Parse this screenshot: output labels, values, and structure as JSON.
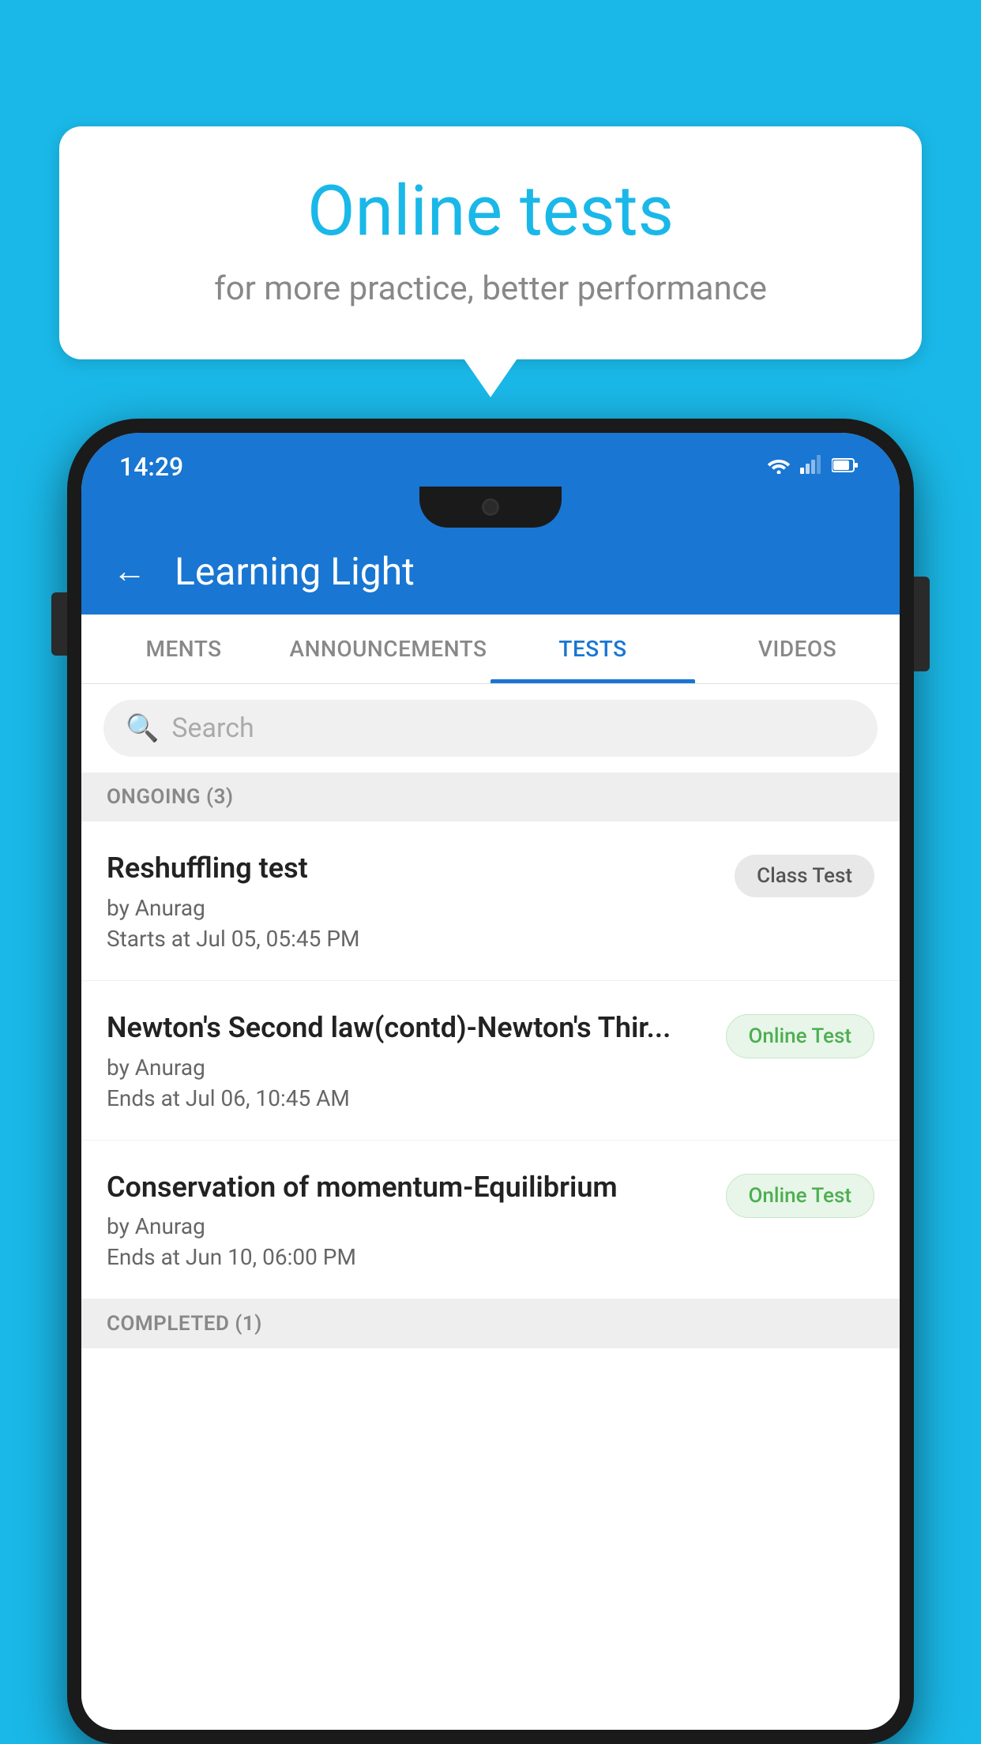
{
  "background_color": "#1ab8e8",
  "speech_bubble": {
    "title": "Online tests",
    "subtitle": "for more practice, better performance"
  },
  "phone": {
    "status_bar": {
      "time": "14:29",
      "icons": [
        "wifi",
        "signal",
        "battery"
      ]
    },
    "app_header": {
      "title": "Learning Light",
      "back_label": "←"
    },
    "tabs": [
      {
        "label": "MENTS",
        "active": false
      },
      {
        "label": "ANNOUNCEMENTS",
        "active": false
      },
      {
        "label": "TESTS",
        "active": true
      },
      {
        "label": "VIDEOS",
        "active": false
      }
    ],
    "search": {
      "placeholder": "Search"
    },
    "ongoing_section": {
      "label": "ONGOING (3)"
    },
    "tests": [
      {
        "title": "Reshuffling test",
        "author": "by Anurag",
        "date": "Starts at  Jul 05, 05:45 PM",
        "badge": "Class Test",
        "badge_type": "class"
      },
      {
        "title": "Newton's Second law(contd)-Newton's Thir...",
        "author": "by Anurag",
        "date": "Ends at  Jul 06, 10:45 AM",
        "badge": "Online Test",
        "badge_type": "online"
      },
      {
        "title": "Conservation of momentum-Equilibrium",
        "author": "by Anurag",
        "date": "Ends at  Jun 10, 06:00 PM",
        "badge": "Online Test",
        "badge_type": "online"
      }
    ],
    "completed_section": {
      "label": "COMPLETED (1)"
    }
  }
}
